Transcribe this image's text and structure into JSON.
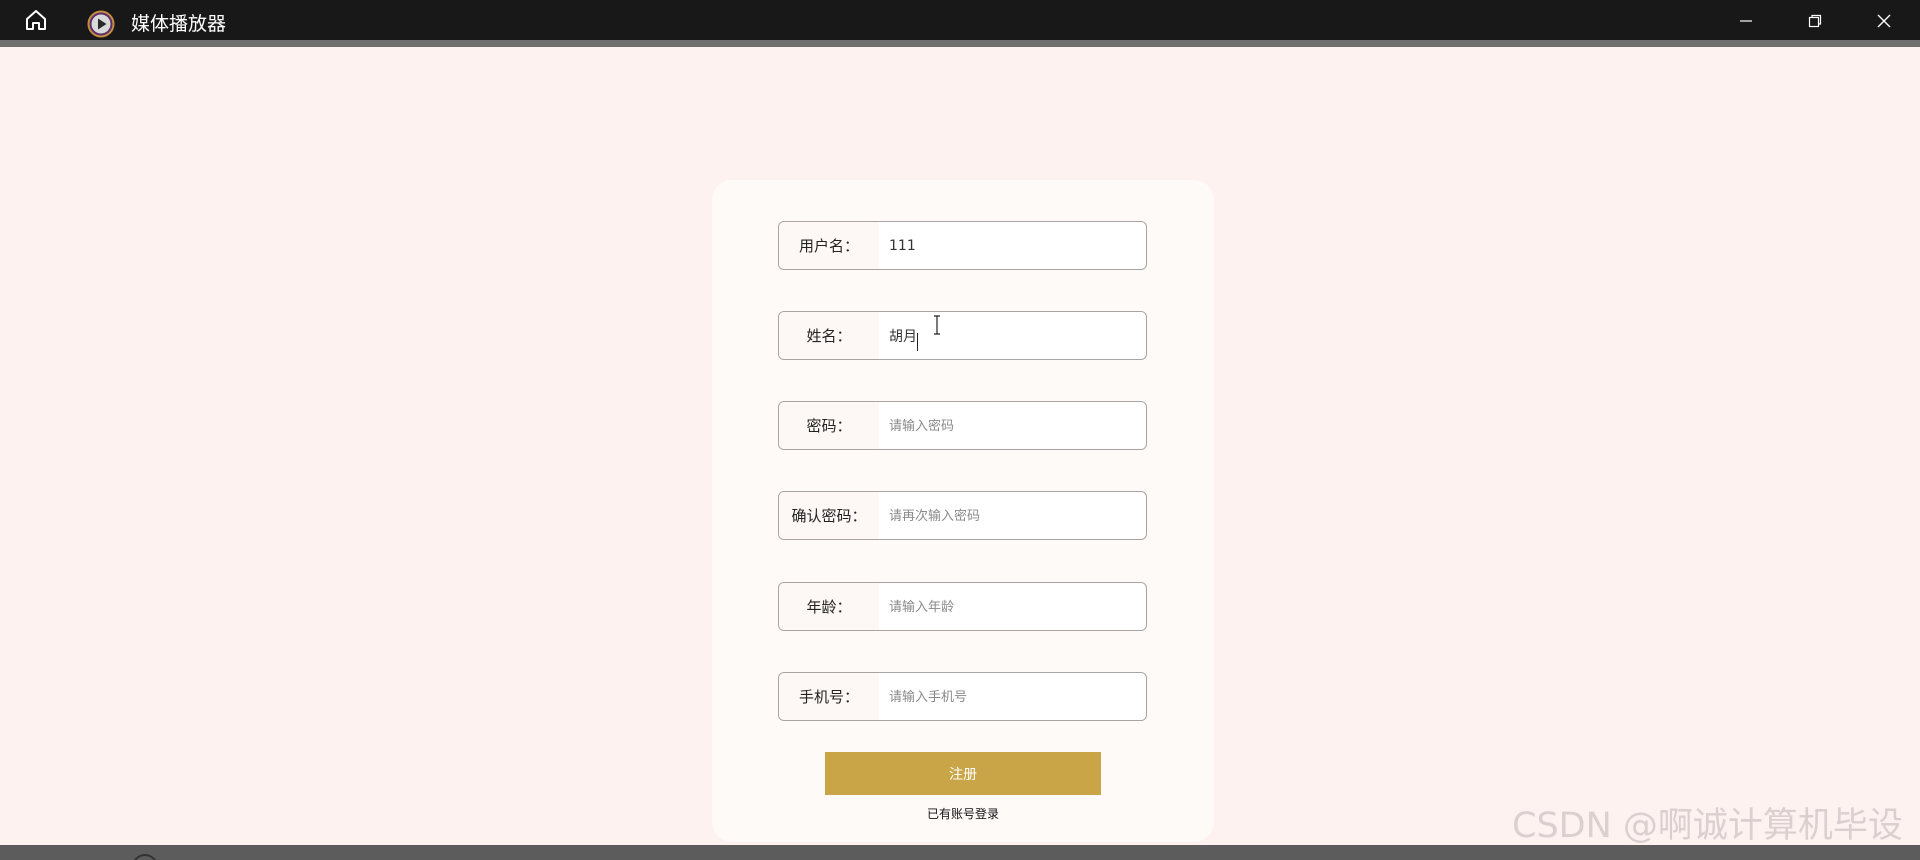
{
  "titlebar": {
    "app_title": "媒体播放器",
    "icons": {
      "home": "home-icon",
      "logo": "media-player-logo-icon",
      "minimize": "minimize-icon",
      "maximize": "restore-icon",
      "close": "close-icon"
    },
    "colors": {
      "background": "#181818",
      "logo_ring": "#c68f3f",
      "logo_fill": "#5a2f6e"
    }
  },
  "form": {
    "fields": [
      {
        "label": "用户名：",
        "value": "111",
        "placeholder": ""
      },
      {
        "label": "姓名：",
        "value": "胡月",
        "placeholder": ""
      },
      {
        "label": "密码：",
        "value": "",
        "placeholder": "请输入密码"
      },
      {
        "label": "确认密码：",
        "value": "",
        "placeholder": "请再次输入密码"
      },
      {
        "label": "年龄：",
        "value": "",
        "placeholder": "请输入年龄"
      },
      {
        "label": "手机号：",
        "value": "",
        "placeholder": "请输入手机号"
      }
    ],
    "submit_label": "注册",
    "login_link": "已有账号登录",
    "colors": {
      "page_bg": "#fdf2f0",
      "card_bg": "#fefaf8",
      "accent": "#c9a547"
    }
  },
  "watermark": "CSDN @啊诚计算机毕设"
}
